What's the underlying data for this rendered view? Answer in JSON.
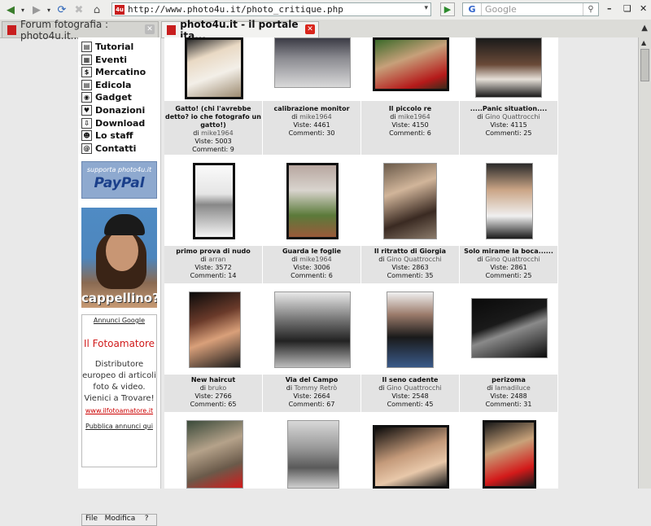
{
  "browser": {
    "url": "http://www.photo4u.it/photo_critique.php",
    "search_engine": "G",
    "search_placeholder": "Google",
    "tabs": [
      {
        "label": "Forum fotografia : photo4u.it..."
      },
      {
        "label": "photo4u.it - il portale ita..."
      }
    ],
    "fav_label": "4u"
  },
  "nav": {
    "items": [
      {
        "label": "Tutorial",
        "icon": "book-icon"
      },
      {
        "label": "Eventi",
        "icon": "calendar-icon"
      },
      {
        "label": "Mercatino",
        "icon": "dollar-icon"
      },
      {
        "label": "Edicola",
        "icon": "newspaper-icon"
      },
      {
        "label": "Gadget",
        "icon": "camera-icon"
      },
      {
        "label": "Donazioni",
        "icon": "donation-icon"
      },
      {
        "label": "Download",
        "icon": "download-icon"
      },
      {
        "label": "Lo staff",
        "icon": "people-icon"
      },
      {
        "label": "Contatti",
        "icon": "at-icon"
      }
    ]
  },
  "paypal": {
    "support": "supporta photo4u.it",
    "brand": "PayPal"
  },
  "promo": {
    "label": "cappellino?"
  },
  "ads": {
    "header": "Annunci Google",
    "title": "Il Fotoamatore",
    "desc": "Distributore europeo di articoli foto & video. Vienici a Trovare!",
    "link": "www.ilfotoamatore.it",
    "publish": "Pubblica annunci qui"
  },
  "minimenu": {
    "file": "File",
    "edit": "Modifica",
    "help": "?"
  },
  "labels": {
    "by": "di",
    "views": "Viste:",
    "comments": "Commenti:"
  },
  "photos": [
    {
      "title": "Gatto! (chi l'avrebbe detto? io che fotografo un gatto!)",
      "author": "mike1964",
      "views": "5003",
      "comments": "9"
    },
    {
      "title": "calibrazione monitor",
      "author": "mike1964",
      "views": "4461",
      "comments": "30"
    },
    {
      "title": "Il piccolo re",
      "author": "mike1964",
      "views": "4150",
      "comments": "6"
    },
    {
      "title": ".....Panic situation....",
      "author": "Gino Quattrocchi",
      "views": "4115",
      "comments": "25"
    },
    {
      "title": "primo prova di nudo",
      "author": "arran",
      "views": "3572",
      "comments": "14"
    },
    {
      "title": "Guarda le foglie",
      "author": "mike1964",
      "views": "3006",
      "comments": "6"
    },
    {
      "title": "Il ritratto di Giorgia",
      "author": "Gino Quattrocchi",
      "views": "2863",
      "comments": "35"
    },
    {
      "title": "Solo mirame la boca......",
      "author": "Gino Quattrocchi",
      "views": "2861",
      "comments": "25"
    },
    {
      "title": "New haircut",
      "author": "bruko",
      "views": "2766",
      "comments": "65"
    },
    {
      "title": "Via del Campo",
      "author": "Tommy Retrò",
      "views": "2664",
      "comments": "67"
    },
    {
      "title": "Il seno cadente",
      "author": "Gino Quattrocchi",
      "views": "2548",
      "comments": "45"
    },
    {
      "title": "perizoma",
      "author": "lamadiluce",
      "views": "2488",
      "comments": "31"
    }
  ]
}
